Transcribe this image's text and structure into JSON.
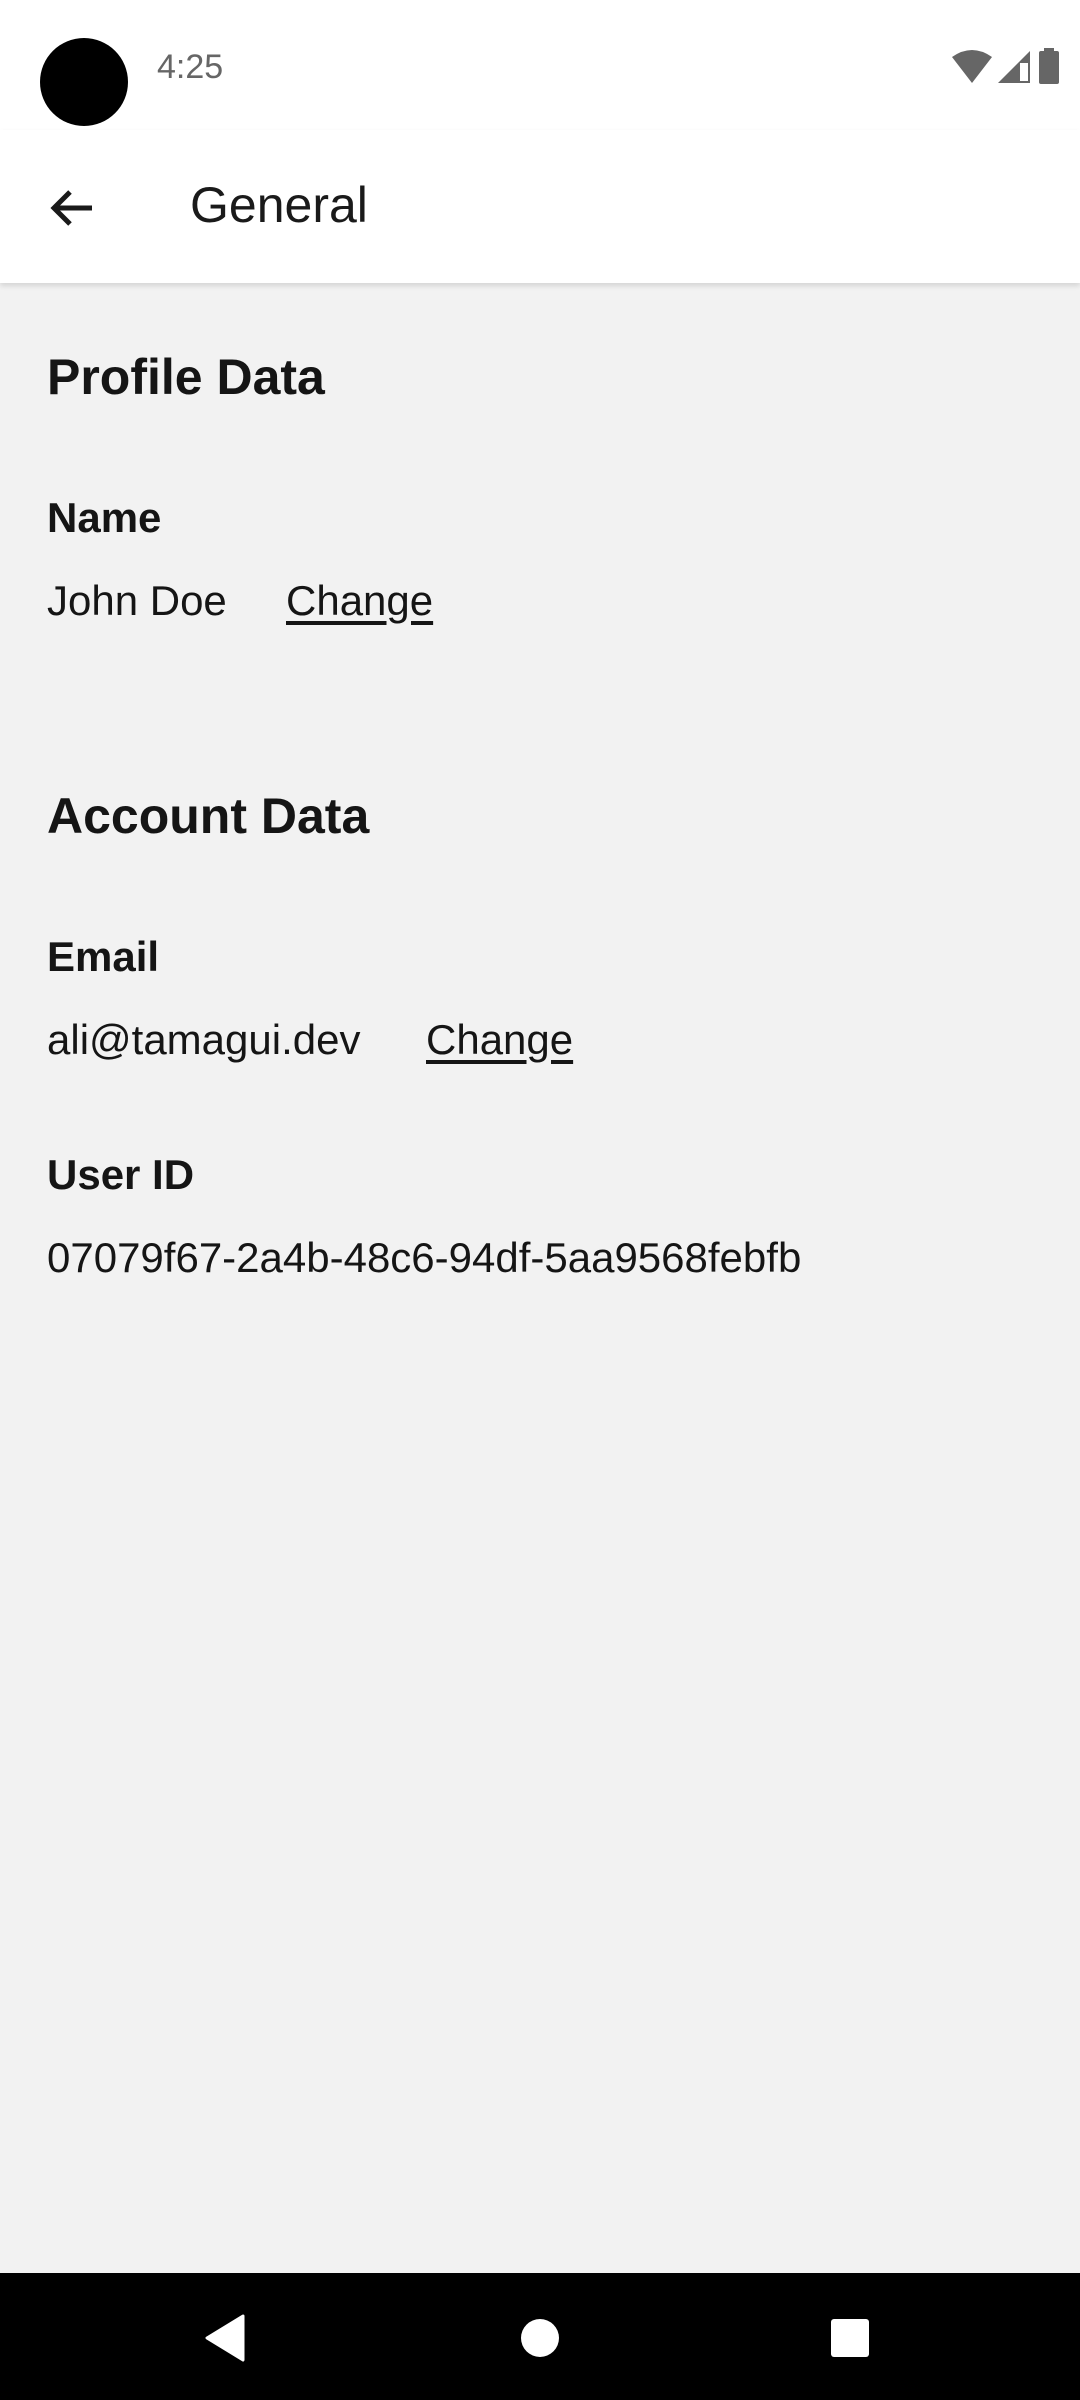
{
  "status_bar": {
    "time": "4:25",
    "icons": [
      "wifi-icon",
      "signal-icon",
      "battery-icon"
    ]
  },
  "app_bar": {
    "title": "General",
    "back_icon": "arrow-left-icon"
  },
  "profile": {
    "heading": "Profile Data",
    "name_label": "Name",
    "name_value": "John Doe",
    "change_label": "Change"
  },
  "account": {
    "heading": "Account Data",
    "email_label": "Email",
    "email_value": "ali@tamagui.dev",
    "change_label": "Change",
    "user_id_label": "User ID",
    "user_id_value": "07079f67-2a4b-48c6-94df-5aa9568febfb"
  },
  "nav_bar": {
    "icons": [
      "back-triangle-icon",
      "home-circle-icon",
      "recents-square-icon"
    ]
  }
}
